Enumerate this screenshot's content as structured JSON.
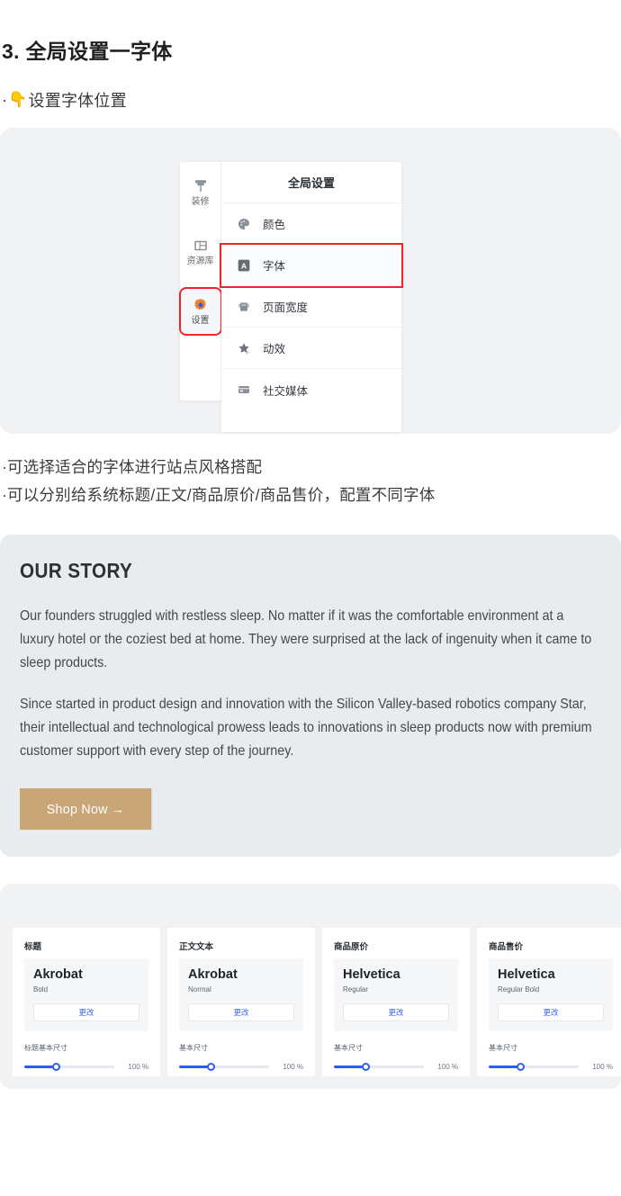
{
  "doc": {
    "title": "3. 全局设置一字体",
    "pointer_bullet": {
      "marker": "·",
      "emoji": "👇",
      "text": "设置字体位置"
    },
    "bullets": [
      "·可选择适合的字体进行站点风格搭配",
      "·可以分别给系统标题/正文/商品原价/商品售价，配置不同字体"
    ]
  },
  "settings_ui": {
    "rail": [
      {
        "label": "装修",
        "icon": "paintbrush-icon",
        "active": false
      },
      {
        "label": "资源库",
        "icon": "library-layout-icon",
        "active": false
      },
      {
        "label": "设置",
        "icon": "gear-icon",
        "active": true,
        "highlighted": true
      }
    ],
    "panel_header": "全局设置",
    "menu": [
      {
        "label": "颜色",
        "icon": "palette-icon",
        "selected": false
      },
      {
        "label": "字体",
        "icon": "font-a-icon",
        "selected": true
      },
      {
        "label": "页面宽度",
        "icon": "page-width-icon",
        "selected": false
      },
      {
        "label": "动效",
        "icon": "star-motion-icon",
        "selected": false
      },
      {
        "label": "社交媒体",
        "icon": "social-media-card-icon",
        "selected": false
      }
    ],
    "highlight_color": "#f5222d",
    "accent_color": "#2f5cf0"
  },
  "story_preview": {
    "heading": "OUR STORY",
    "paragraph_1": "Our founders struggled with restless sleep. No matter if it was the comfortable environment at a luxury hotel or the coziest bed at home. They were surprised at the lack of ingenuity when it came to sleep products.",
    "paragraph_2": "Since started in product design and innovation with the Silicon Valley-based robotics company Star, their intellectual and technological prowess leads to innovations in sleep products now with premium customer support with every step of the journey.",
    "cta_label": "Shop Now →",
    "cta_color": "#c9a678",
    "background_color": "#e9ecee"
  },
  "font_cards": [
    {
      "title": "标题",
      "font_name": "Akrobat",
      "font_style": "Bold",
      "change_label": "更改",
      "size_label": "标题基本尺寸",
      "size_value": "100 %",
      "size_percent": 100
    },
    {
      "title": "正文文本",
      "font_name": "Akrobat",
      "font_style": "Normal",
      "change_label": "更改",
      "size_label": "基本尺寸",
      "size_value": "100 %",
      "size_percent": 100
    },
    {
      "title": "商品原价",
      "font_name": "Helvetica",
      "font_style": "Regular",
      "change_label": "更改",
      "size_label": "基本尺寸",
      "size_value": "100 %",
      "size_percent": 100
    },
    {
      "title": "商品售价",
      "font_name": "Helvetica",
      "font_style": "Regular Bold",
      "change_label": "更改",
      "size_label": "基本尺寸",
      "size_value": "100 %",
      "size_percent": 100
    }
  ]
}
